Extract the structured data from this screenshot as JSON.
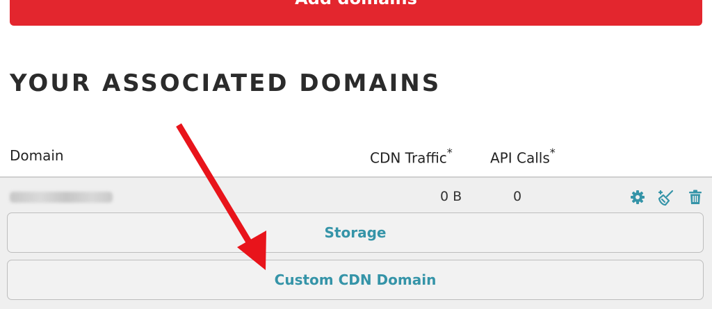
{
  "header": {
    "add_domains_label": "Add domains"
  },
  "section": {
    "title": "YOUR ASSOCIATED DOMAINS"
  },
  "table": {
    "columns": {
      "domain": "Domain",
      "cdn_traffic": "CDN Traffic",
      "api_calls": "API Calls",
      "asterisk": "*"
    },
    "rows": [
      {
        "cdn_traffic": "0 B",
        "api_calls": "0"
      }
    ]
  },
  "actions": {
    "storage_label": "Storage",
    "custom_cdn_label": "Custom CDN Domain"
  },
  "icons": {
    "settings": "gear-icon",
    "clear_cache": "broom-icon",
    "delete": "trash-icon"
  },
  "colors": {
    "brand_red": "#e3262e",
    "accent_teal": "#3594a8",
    "annotation_arrow": "#e8141b"
  }
}
